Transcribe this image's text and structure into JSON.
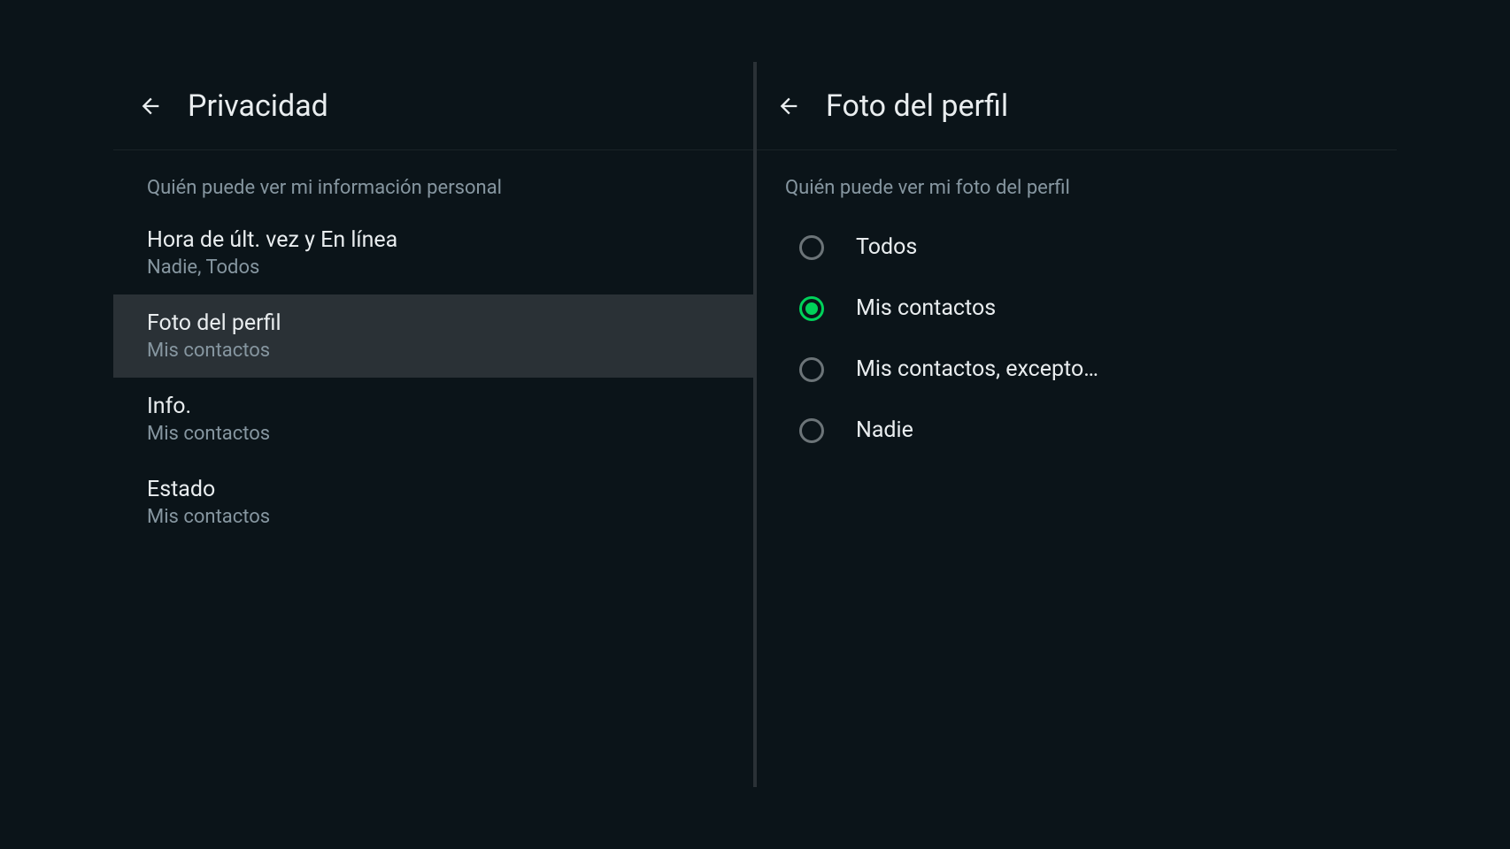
{
  "left": {
    "title": "Privacidad",
    "section_label": "Quién puede ver mi información personal",
    "items": [
      {
        "title": "Hora de últ. vez y En línea",
        "subtitle": "Nadie, Todos",
        "selected": false
      },
      {
        "title": "Foto del perfil",
        "subtitle": "Mis contactos",
        "selected": true
      },
      {
        "title": "Info.",
        "subtitle": "Mis contactos",
        "selected": false
      },
      {
        "title": "Estado",
        "subtitle": "Mis contactos",
        "selected": false
      }
    ]
  },
  "right": {
    "title": "Foto del perfil",
    "section_label": "Quién puede ver mi foto del perfil",
    "options": [
      {
        "label": "Todos",
        "checked": false
      },
      {
        "label": "Mis contactos",
        "checked": true
      },
      {
        "label": "Mis contactos, excepto…",
        "checked": false
      },
      {
        "label": "Nadie",
        "checked": false
      }
    ]
  }
}
